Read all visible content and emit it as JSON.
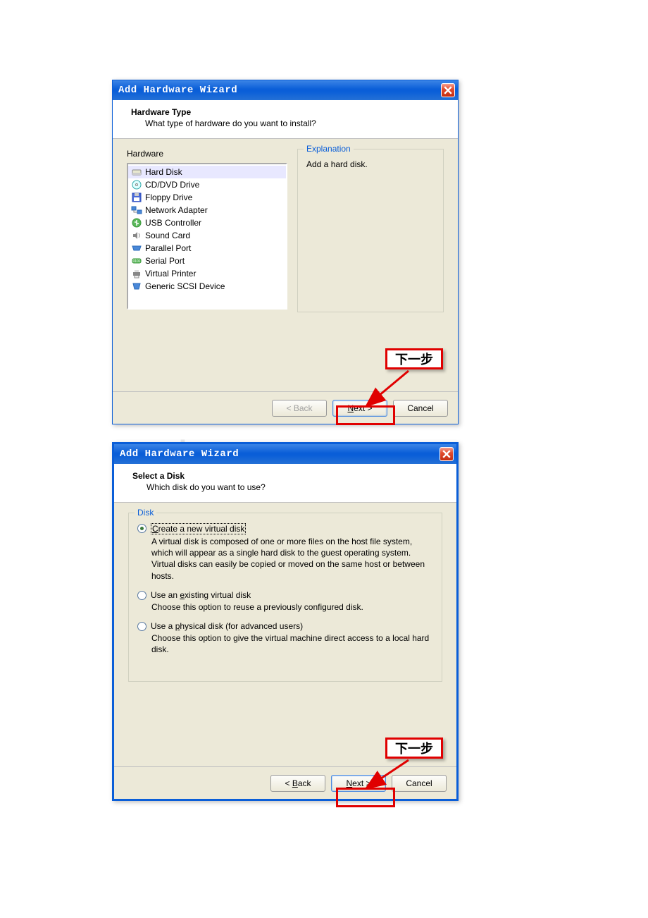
{
  "watermark": ".baocx.co",
  "dialog1": {
    "title": "Add Hardware Wizard",
    "header_title": "Hardware Type",
    "header_sub": "What type of hardware do you want to install?",
    "hardware_legend": "Hardware",
    "explanation_legend": "Explanation",
    "explanation_text": "Add a hard disk.",
    "items": [
      "Hard Disk",
      "CD/DVD Drive",
      "Floppy Drive",
      "Network Adapter",
      "USB Controller",
      "Sound Card",
      "Parallel Port",
      "Serial Port",
      "Virtual Printer",
      "Generic SCSI Device"
    ],
    "buttons": {
      "back": "< Back",
      "next": "Next >",
      "cancel": "Cancel"
    }
  },
  "dialog2": {
    "title": "Add Hardware Wizard",
    "header_title": "Select a Disk",
    "header_sub": "Which disk do you want to use?",
    "disk_legend": "Disk",
    "options": [
      {
        "label_pre": "",
        "label_u": "C",
        "label_post": "reate a new virtual disk",
        "desc": "A virtual disk is composed of one or more files on the host file system, which will appear as a single hard disk to the guest operating system. Virtual disks can easily be copied or moved on the same host or between hosts."
      },
      {
        "label_pre": "Use an ",
        "label_u": "e",
        "label_post": "xisting virtual disk",
        "desc": "Choose this option to reuse a previously configured disk."
      },
      {
        "label_pre": "Use a ",
        "label_u": "p",
        "label_post": "hysical disk (for advanced users)",
        "desc": "Choose this option to give the virtual machine direct access to a local hard disk."
      }
    ],
    "buttons": {
      "back": "< Back",
      "next": "Next >",
      "cancel": "Cancel"
    }
  },
  "annotation": {
    "next_step": "下一步"
  }
}
